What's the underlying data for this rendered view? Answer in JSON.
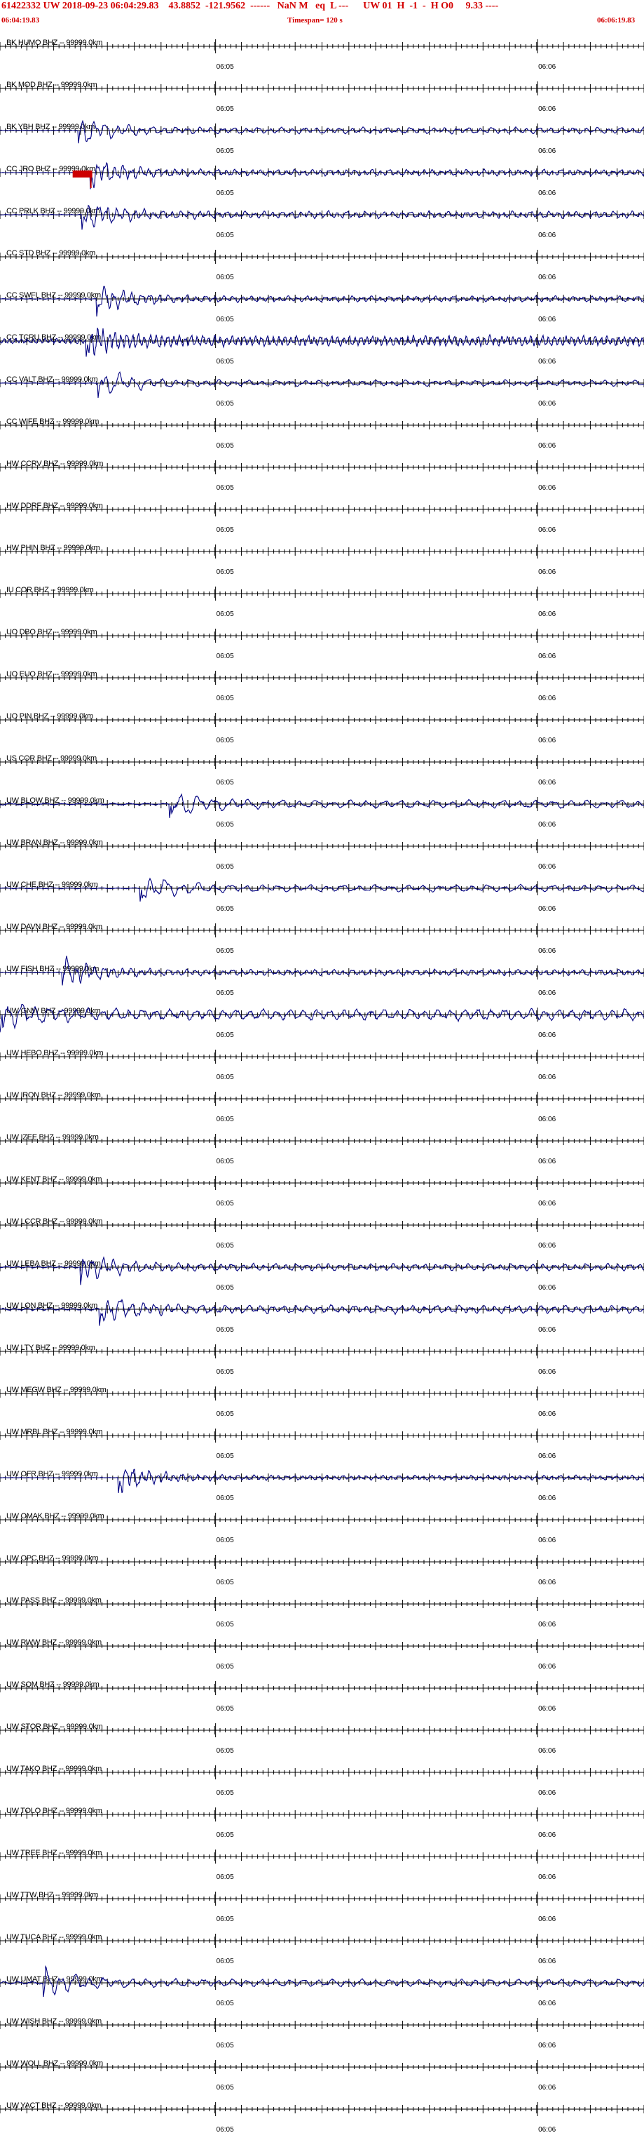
{
  "header": {
    "title": "61422332 UW 2018-09-23 06:04:29.83    43.8852  -121.9562  ------   NaN M   eq  L ---      UW 01  H  -1  -  H O0     9.33 ----",
    "start_time": "06:04:19.83",
    "timespan": "Timespan= 120 s",
    "end_time": "06:06:19.83"
  },
  "colors": {
    "header_text": "#d40000",
    "trace": "#000080",
    "axis": "#000000",
    "pick_marker": "#cc0000"
  },
  "chart_data": {
    "type": "line",
    "title": "61422332 UW 2018-09-23 06:04:29.83",
    "x_unit": "s",
    "xlim": [
      0,
      120
    ],
    "time_ticks": [
      "06:05",
      "06:06"
    ],
    "time_tick_seconds": [
      40.17,
      100.17
    ],
    "grid": false,
    "traces": [
      {
        "label": "BK HUMO BHZ -- 99999.0km",
        "has_signal": false
      },
      {
        "label": "BK MOD BHZ -- 99999.0km",
        "has_signal": false
      },
      {
        "label": "BK YBH BHZ -- 99999.0km",
        "has_signal": true,
        "arrival_s": 14.5,
        "amplitude": 0.55,
        "noise": 0.12,
        "cycles": 55,
        "seed": 3
      },
      {
        "label": "CC JRO BHZ -- 99999.0km",
        "has_signal": true,
        "arrival_s": 16.8,
        "amplitude": 0.6,
        "noise": 0.05,
        "cycles": 75,
        "seed": 5,
        "pick_s": 16.8
      },
      {
        "label": "CC PRLK BHZ -- 99999.0km",
        "has_signal": true,
        "arrival_s": 15.2,
        "amplitude": 0.65,
        "noise": 0.1,
        "cycles": 70,
        "seed": 7
      },
      {
        "label": "CC STD BHZ -- 99999.0km",
        "has_signal": false
      },
      {
        "label": "CC SWFL BHZ -- 99999.0km",
        "has_signal": true,
        "arrival_s": 18.0,
        "amplitude": 0.55,
        "noise": 0.08,
        "cycles": 70,
        "seed": 11
      },
      {
        "label": "CC TCRU BHZ -- 99999.0km",
        "has_signal": true,
        "arrival_s": 16.0,
        "amplitude": 0.7,
        "noise": 0.65,
        "cycles": 110,
        "seed": 13
      },
      {
        "label": "CC VALT BHZ -- 99999.0km",
        "has_signal": true,
        "arrival_s": 18.2,
        "amplitude": 0.55,
        "noise": 0.06,
        "cycles": 45,
        "seed": 17
      },
      {
        "label": "CC WIFE BHZ -- 99999.0km",
        "has_signal": false
      },
      {
        "label": "HW CCRV BHZ -- 99999.0km",
        "has_signal": false
      },
      {
        "label": "HW DDRF BHZ -- 99999.0km",
        "has_signal": false
      },
      {
        "label": "HW PHIN BHZ -- 99999.0km",
        "has_signal": false
      },
      {
        "label": "IU COR BHZ -- 99999.0km",
        "has_signal": false
      },
      {
        "label": "UO DBO BHZ -- 99999.0km",
        "has_signal": false
      },
      {
        "label": "UO EUO BHZ -- 99999.0km",
        "has_signal": false
      },
      {
        "label": "UO PIN BHZ -- 99999.0km",
        "has_signal": false
      },
      {
        "label": "US COR BHZ -- 99999.0km",
        "has_signal": false
      },
      {
        "label": "UW BLOW BHZ -- 99999.0km",
        "has_signal": true,
        "arrival_s": 31.5,
        "amplitude": 0.65,
        "noise": 0.25,
        "cycles": 38,
        "seed": 19
      },
      {
        "label": "UW BRAN BHZ -- 99999.0km",
        "has_signal": false
      },
      {
        "label": "UW CHE BHZ -- 99999.0km",
        "has_signal": true,
        "arrival_s": 26.0,
        "amplitude": 0.6,
        "noise": 0.15,
        "cycles": 40,
        "seed": 23
      },
      {
        "label": "UW DAVN BHZ -- 99999.0km",
        "has_signal": false
      },
      {
        "label": "UW FISH BHZ -- 99999.0km",
        "has_signal": true,
        "arrival_s": 11.5,
        "amplitude": 0.55,
        "noise": 0.1,
        "cycles": 70,
        "seed": 29
      },
      {
        "label": "UW GNW BHZ -- 99999.0km",
        "has_signal": true,
        "arrival_s": 0.0,
        "amplitude": 0.7,
        "noise": 0.7,
        "cycles": 48,
        "seed": 31
      },
      {
        "label": "UW HEBO BHZ -- 99999.0km",
        "has_signal": false
      },
      {
        "label": "UW IRON BHZ -- 99999.0km",
        "has_signal": false
      },
      {
        "label": "UW IZEE BHZ -- 99999.0km",
        "has_signal": false
      },
      {
        "label": "UW KENT BHZ -- 99999.0km",
        "has_signal": false
      },
      {
        "label": "UW LCCR BHZ -- 99999.0km",
        "has_signal": false
      },
      {
        "label": "UW LEBA BHZ -- 99999.0km",
        "has_signal": true,
        "arrival_s": 15.0,
        "amplitude": 0.6,
        "noise": 0.2,
        "cycles": 60,
        "seed": 37
      },
      {
        "label": "UW LON BHZ -- 99999.0km",
        "has_signal": true,
        "arrival_s": 18.5,
        "amplitude": 0.65,
        "noise": 0.3,
        "cycles": 55,
        "seed": 41
      },
      {
        "label": "UW LTY BHZ -- 99999.0km",
        "has_signal": false
      },
      {
        "label": "UW MEGW BHZ -- 99999.0km",
        "has_signal": false
      },
      {
        "label": "UW MRBL BHZ -- 99999.0km",
        "has_signal": false
      },
      {
        "label": "UW OFR BHZ -- 99999.0km",
        "has_signal": true,
        "arrival_s": 22.0,
        "amplitude": 0.45,
        "noise": 0.06,
        "cycles": 80,
        "seed": 43
      },
      {
        "label": "UW OMAK BHZ -- 99999.0km",
        "has_signal": false
      },
      {
        "label": "UW OPC BHZ -- 99999.0km",
        "has_signal": false
      },
      {
        "label": "UW PASS BHZ -- 99999.0km",
        "has_signal": false
      },
      {
        "label": "UW RWW BHZ -- 99999.0km",
        "has_signal": false
      },
      {
        "label": "UW SQM BHZ -- 99999.0km",
        "has_signal": false
      },
      {
        "label": "UW STOR BHZ -- 99999.0km",
        "has_signal": false
      },
      {
        "label": "UW TAKO BHZ -- 99999.0km",
        "has_signal": false
      },
      {
        "label": "UW TOLO BHZ -- 99999.0km",
        "has_signal": false
      },
      {
        "label": "UW TREE BHZ -- 99999.0km",
        "has_signal": false
      },
      {
        "label": "UW TTW BHZ -- 99999.0km",
        "has_signal": false
      },
      {
        "label": "UW TUCA BHZ -- 99999.0km",
        "has_signal": false
      },
      {
        "label": "UW UMAT BHZ -- 99999.0km",
        "has_signal": true,
        "arrival_s": 8.0,
        "amplitude": 0.55,
        "noise": 0.35,
        "cycles": 45,
        "seed": 47
      },
      {
        "label": "UW WISH BHZ -- 99999.0km",
        "has_signal": false
      },
      {
        "label": "UW WOLL BHZ -- 99999.0km",
        "has_signal": false
      },
      {
        "label": "UW YACT BHZ -- 99999.0km",
        "has_signal": false
      }
    ]
  }
}
